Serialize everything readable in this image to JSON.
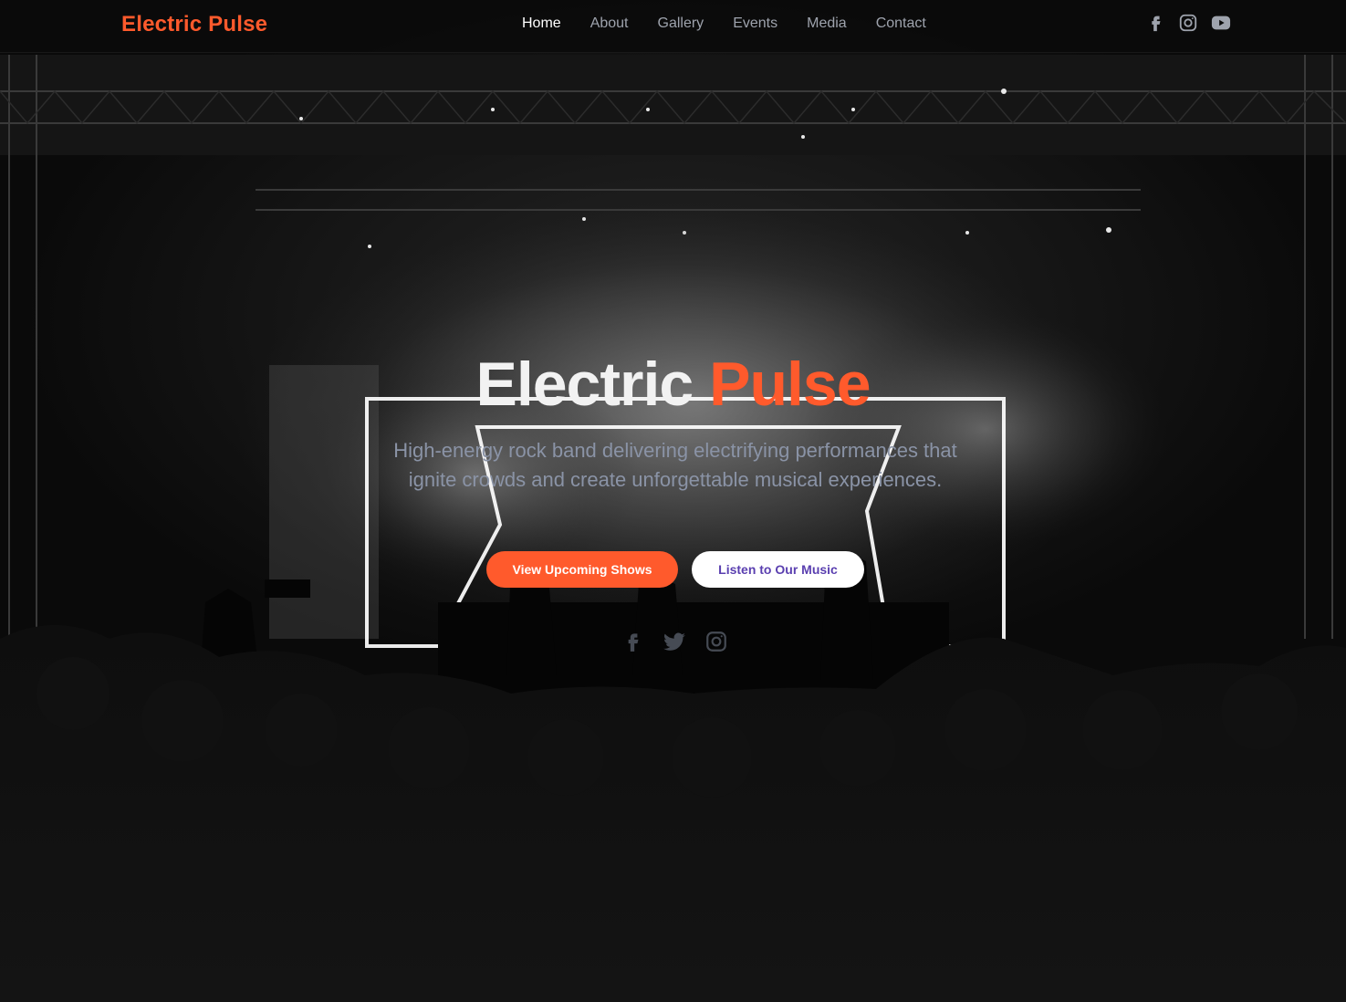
{
  "nav": {
    "brand": "Electric Pulse",
    "items": [
      {
        "label": "Home",
        "active": true
      },
      {
        "label": "About",
        "active": false
      },
      {
        "label": "Gallery",
        "active": false
      },
      {
        "label": "Events",
        "active": false
      },
      {
        "label": "Media",
        "active": false
      },
      {
        "label": "Contact",
        "active": false
      }
    ],
    "social_icons": [
      "facebook-icon",
      "instagram-icon",
      "youtube-icon"
    ]
  },
  "hero": {
    "title_main": "Electric",
    "title_accent": "Pulse",
    "subtitle": "High-energy rock band delivering electrifying performances that ignite crowds and create unforgettable musical experiences.",
    "primary_button": "View Upcoming Shows",
    "secondary_button": "Listen to Our Music",
    "social_icons": [
      "facebook-icon",
      "twitter-icon",
      "instagram-icon"
    ]
  },
  "colors": {
    "accent": "#ff5a2c",
    "nav_text": "#9ea3ad",
    "subtitle_text": "#8a93a6",
    "secondary_button_text": "#5a3fb0",
    "background": "#0a0a0a"
  }
}
